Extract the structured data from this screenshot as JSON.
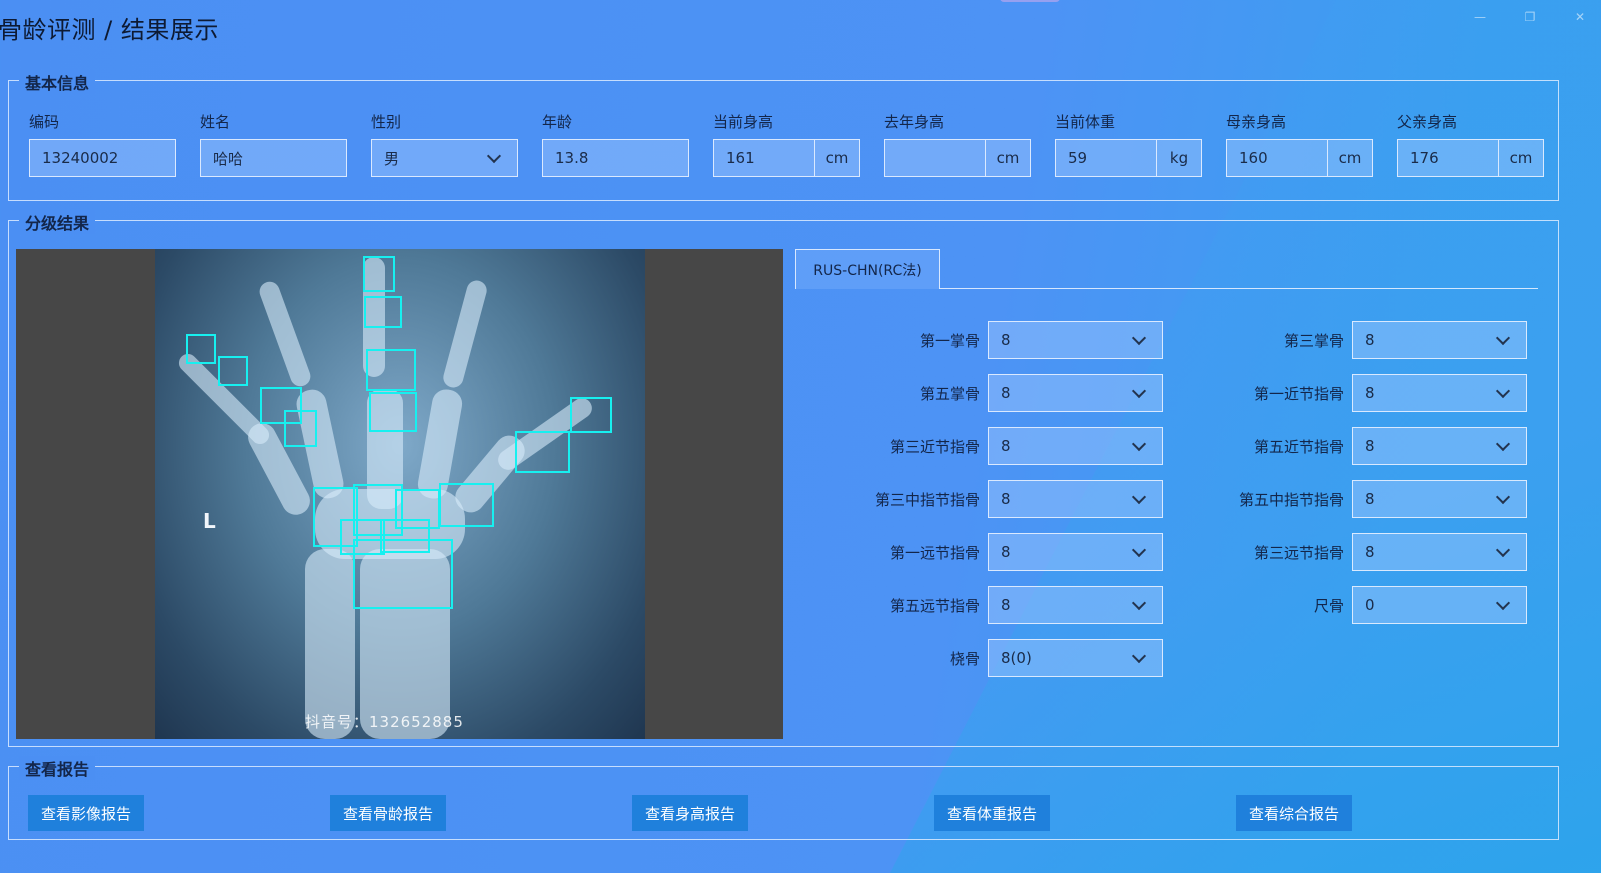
{
  "window": {
    "title": "骨龄评测 / 结果展示"
  },
  "basic_info": {
    "legend": "基本信息",
    "fields": [
      {
        "label": "编码",
        "value": "13240002"
      },
      {
        "label": "姓名",
        "value": "哈哈"
      },
      {
        "label": "性别",
        "value": "男"
      },
      {
        "label": "年龄",
        "value": "13.8"
      },
      {
        "label": "当前身高",
        "value": "161",
        "unit": "cm"
      },
      {
        "label": "去年身高",
        "value": "",
        "unit": "cm"
      },
      {
        "label": "当前体重",
        "value": "59",
        "unit": "kg"
      },
      {
        "label": "母亲身高",
        "value": "160",
        "unit": "cm"
      },
      {
        "label": "父亲身高",
        "value": "176",
        "unit": "cm"
      }
    ]
  },
  "grading": {
    "legend": "分级结果",
    "image": {
      "side_marker": "L",
      "watermark": "抖音号：132652885"
    },
    "tab": "RUS-CHN(RC法)",
    "items": [
      {
        "label": "第一掌骨",
        "value": "8"
      },
      {
        "label": "第三掌骨",
        "value": "8"
      },
      {
        "label": "第五掌骨",
        "value": "8"
      },
      {
        "label": "第一近节指骨",
        "value": "8"
      },
      {
        "label": "第三近节指骨",
        "value": "8"
      },
      {
        "label": "第五近节指骨",
        "value": "8"
      },
      {
        "label": "第三中指节指骨",
        "value": "8"
      },
      {
        "label": "第五中指节指骨",
        "value": "8"
      },
      {
        "label": "第一远节指骨",
        "value": "8"
      },
      {
        "label": "第三远节指骨",
        "value": "8"
      },
      {
        "label": "第五远节指骨",
        "value": "8"
      },
      {
        "label": "尺骨",
        "value": "0"
      },
      {
        "label": "桡骨",
        "value": "8(0)"
      }
    ]
  },
  "reports": {
    "legend": "查看报告",
    "buttons": [
      "查看影像报告",
      "查看骨龄报告",
      "查看身高报告",
      "查看体重报告",
      "查看综合报告"
    ]
  },
  "colors": {
    "accent": "#1f80dc",
    "detection_box": "#17f0f0",
    "background": "#4b8ff3"
  }
}
